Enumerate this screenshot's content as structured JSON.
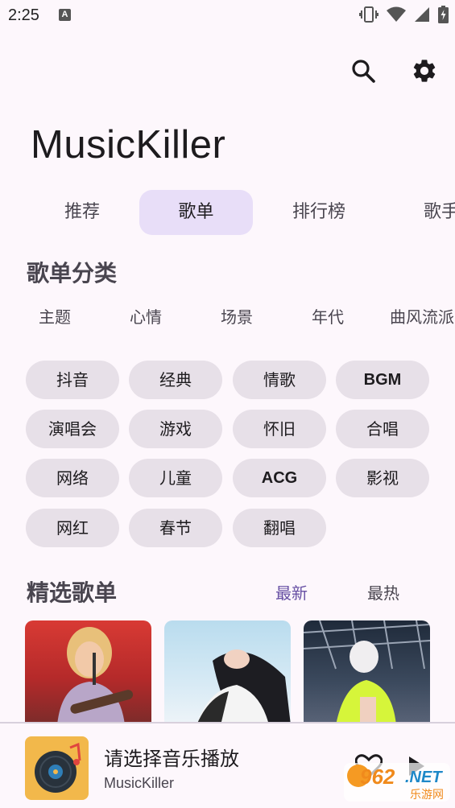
{
  "status_bar": {
    "time": "2:25",
    "badge": "A",
    "icons": [
      "vibrate-icon",
      "wifi-icon",
      "signal-icon",
      "battery-icon"
    ]
  },
  "toolbar": {
    "icons": [
      "search-icon",
      "gear-icon"
    ]
  },
  "app": {
    "title": "MusicKiller"
  },
  "tabs": [
    {
      "label": "推荐",
      "active": false
    },
    {
      "label": "歌单",
      "active": true
    },
    {
      "label": "排行榜",
      "active": false
    },
    {
      "label": "歌手",
      "active": false
    }
  ],
  "category_section": {
    "title": "歌单分类",
    "categories": [
      "主题",
      "心情",
      "场景",
      "年代",
      "曲风流派"
    ]
  },
  "tags": [
    "抖音",
    "经典",
    "情歌",
    "BGM",
    "演唱会",
    "游戏",
    "怀旧",
    "合唱",
    "网络",
    "儿童",
    "ACG",
    "影视",
    "网红",
    "春节",
    "翻唱"
  ],
  "featured_section": {
    "title": "精选歌单",
    "filters": [
      {
        "label": "最新",
        "active": true
      },
      {
        "label": "最热",
        "active": false
      }
    ]
  },
  "player": {
    "title": "请选择音乐播放",
    "subtitle": "MusicKiller",
    "icons": [
      "album-art",
      "heart-icon",
      "play-icon"
    ]
  },
  "watermark": {
    "text": "962.NET",
    "sub": "乐游网"
  },
  "colors": {
    "background": "#fdf7fc",
    "accent": "#6750a4",
    "active_tab": "#e8def8",
    "chip": "#e7e0e8"
  }
}
